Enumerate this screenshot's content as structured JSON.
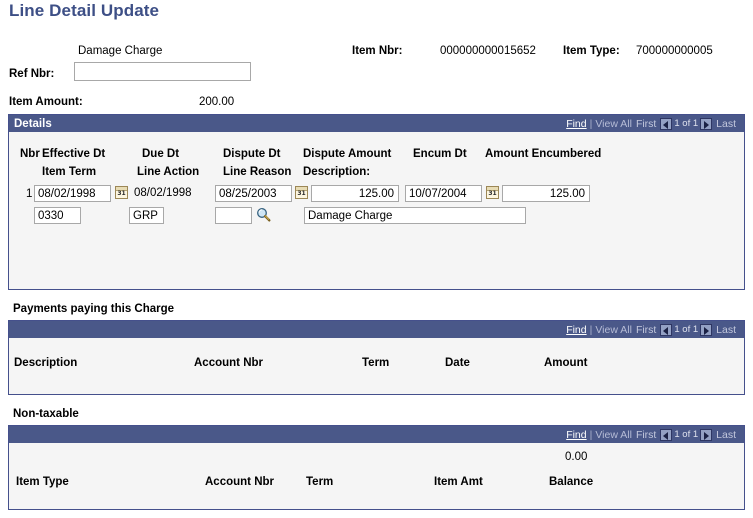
{
  "page": {
    "title": "Line Detail Update"
  },
  "summary": {
    "charge_name": "Damage Charge",
    "ref_nbr_label": "Ref Nbr:",
    "ref_nbr_value": "",
    "ref_nbr_placeholder": "",
    "item_nbr_label": "Item Nbr:",
    "item_nbr_value": "000000000015652",
    "item_type_label": "Item Type:",
    "item_type_value": "700000000005",
    "item_amount_label": "Item Amount:",
    "item_amount_value": "200.00"
  },
  "nav": {
    "find": "Find",
    "separator": "|",
    "view_all": "View All",
    "first": "First",
    "counter": "1 of 1",
    "last": "Last",
    "prev_icon": "left-arrow-icon",
    "next_icon": "right-arrow-icon"
  },
  "details": {
    "title": "Details",
    "headers_row1": [
      "Nbr",
      "Effective Dt",
      "Due Dt",
      "Dispute Dt",
      "Dispute Amount",
      "Encum Dt",
      "Amount Encumbered"
    ],
    "headers_row2": [
      "Item Term",
      "Line Action",
      "Line Reason",
      "Description:"
    ],
    "row": {
      "nbr": "1",
      "effective_dt": "08/02/1998",
      "due_dt": "08/02/1998",
      "dispute_dt": "08/25/2003",
      "dispute_amount": "125.00",
      "encum_dt": "10/07/2004",
      "amount_encumbered": "125.00",
      "item_term": "0330",
      "line_action": "GRP",
      "line_reason": "",
      "description": "Damage Charge",
      "description_wide": ""
    },
    "icons": {
      "calendar": "calendar-icon",
      "lookup": "magnifier-lookup-icon"
    }
  },
  "payments": {
    "caption": "Payments paying this Charge",
    "headers": [
      "Description",
      "Account Nbr",
      "Term",
      "Date",
      "Amount"
    ],
    "rows": []
  },
  "nontaxable": {
    "caption": "Non-taxable",
    "balance_value": "0.00",
    "headers": [
      "Item Type",
      "Account Nbr",
      "Term",
      "Item Amt",
      "Balance"
    ],
    "rows": []
  },
  "colors": {
    "title_blue": "#3d4f86",
    "header_bar": "#4a5889",
    "panel_border": "#45508c",
    "panel_bg": "#f5f5f5"
  }
}
